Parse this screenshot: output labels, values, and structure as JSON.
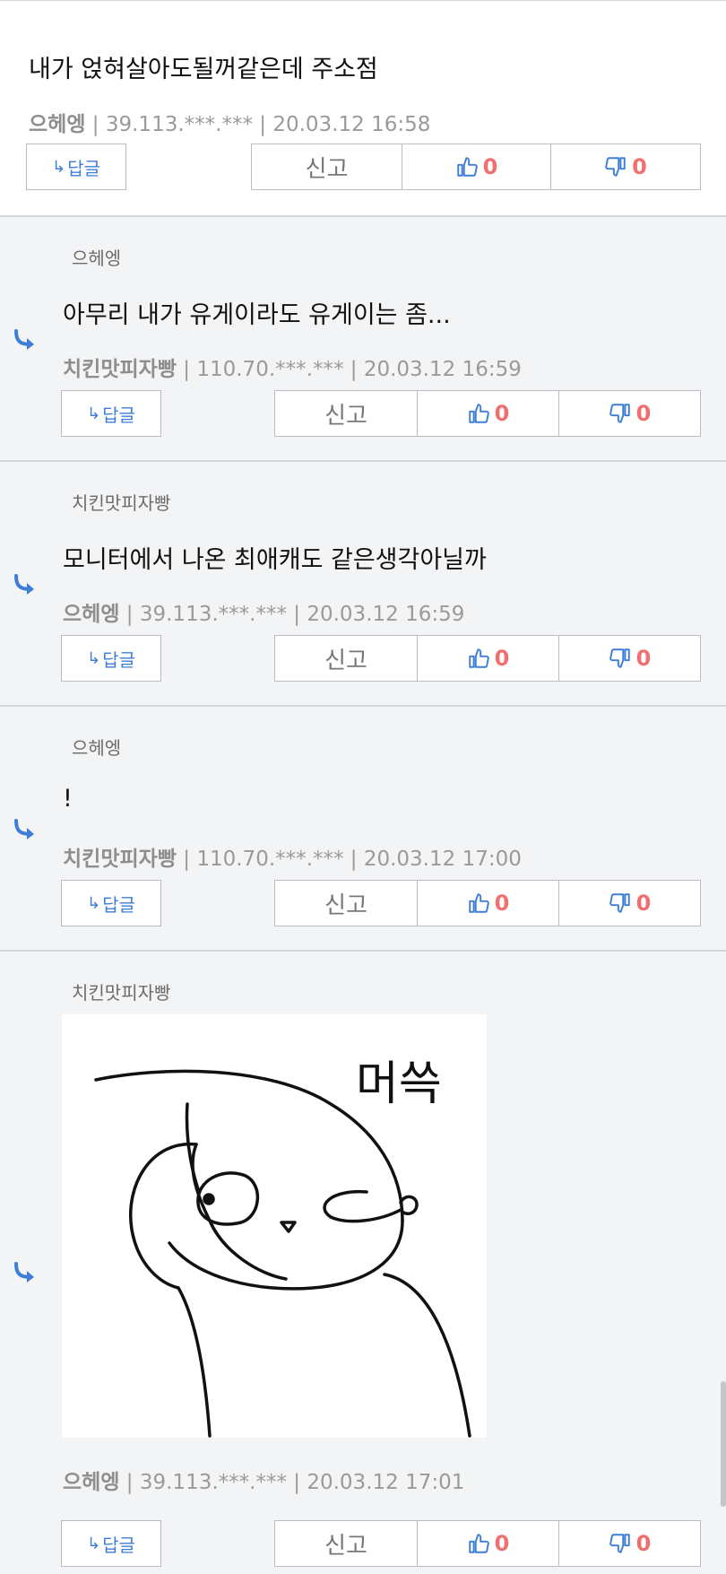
{
  "buttons": {
    "reply_label": "답글",
    "report_label": "신고"
  },
  "colors": {
    "accent": "#3f7ed6",
    "vote_count": "#f07070",
    "reply_bg": "#f3f4f6"
  },
  "comments": [
    {
      "parent": "",
      "text": "내가 얹혀살아도될꺼같은데 주소점",
      "author": "으헤엥",
      "ip": "39.113.***.***",
      "date": "20.03.12 16:58",
      "upvotes": "0",
      "downvotes": "0"
    },
    {
      "parent": "으헤엥",
      "text": "아무리 내가 유게이라도 유게이는 좀...",
      "author": "치킨맛피자빵",
      "ip": "110.70.***.***",
      "date": "20.03.12 16:59",
      "upvotes": "0",
      "downvotes": "0"
    },
    {
      "parent": "치킨맛피자빵",
      "text": "모니터에서 나온 최애캐도 같은생각아닐까",
      "author": "으헤엥",
      "ip": "39.113.***.***",
      "date": "20.03.12 16:59",
      "upvotes": "0",
      "downvotes": "0"
    },
    {
      "parent": "으헤엥",
      "text": "!",
      "author": "치킨맛피자빵",
      "ip": "110.70.***.***",
      "date": "20.03.12 17:00",
      "upvotes": "0",
      "downvotes": "0"
    },
    {
      "parent": "치킨맛피자빵",
      "image_caption": "머쓱",
      "author": "으헤엥",
      "ip": "39.113.***.***",
      "date": "20.03.12 17:01",
      "upvotes": "0",
      "downvotes": "0"
    }
  ]
}
